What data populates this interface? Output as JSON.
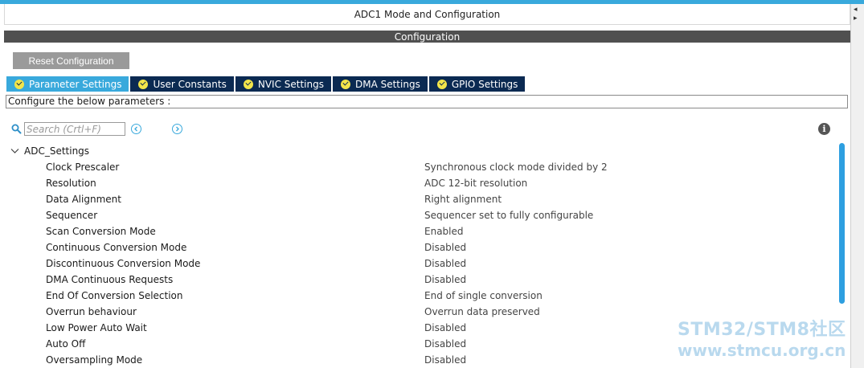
{
  "window": {
    "title": "ADC1 Mode and Configuration"
  },
  "config": {
    "header": "Configuration",
    "reset_label": "Reset Configuration"
  },
  "tabs": [
    {
      "label": "Parameter Settings",
      "active": true
    },
    {
      "label": "User Constants",
      "active": false
    },
    {
      "label": "NVIC Settings",
      "active": false
    },
    {
      "label": "DMA Settings",
      "active": false
    },
    {
      "label": "GPIO Settings",
      "active": false
    }
  ],
  "description": "Configure the below parameters :",
  "search": {
    "placeholder": "Search (Crtl+F)"
  },
  "group": {
    "label": "ADC_Settings",
    "expanded": true
  },
  "params": [
    {
      "name": "Clock Prescaler",
      "value": "Synchronous clock mode divided by 2"
    },
    {
      "name": "Resolution",
      "value": "ADC 12-bit resolution"
    },
    {
      "name": "Data Alignment",
      "value": "Right alignment"
    },
    {
      "name": "Sequencer",
      "value": "Sequencer set to fully configurable"
    },
    {
      "name": "Scan Conversion Mode",
      "value": "Enabled"
    },
    {
      "name": "Continuous Conversion Mode",
      "value": "Disabled"
    },
    {
      "name": "Discontinuous Conversion Mode",
      "value": "Disabled"
    },
    {
      "name": "DMA Continuous Requests",
      "value": "Disabled"
    },
    {
      "name": "End Of Conversion Selection",
      "value": "End of single conversion"
    },
    {
      "name": "Overrun behaviour",
      "value": "Overrun data preserved"
    },
    {
      "name": "Low Power Auto Wait",
      "value": "Disabled"
    },
    {
      "name": "Auto Off",
      "value": "Disabled"
    },
    {
      "name": "Oversampling Mode",
      "value": "Disabled"
    }
  ],
  "watermark": {
    "line1": "STM32/STM8社区",
    "line2": "www.stmcu.org.cn"
  },
  "colors": {
    "accent": "#39a9dc",
    "tab_bg": "#0b2a52",
    "check": "#f2e54a",
    "header_bg": "#505050",
    "reset_bg": "#9a9a9a",
    "scroll_thumb": "#2d9fe0"
  },
  "icons": {
    "search": "search-icon",
    "prev": "chevron-left-circle-icon",
    "next": "chevron-right-circle-icon",
    "info": "info-icon",
    "expand": "chevron-down-icon",
    "tab_status": "check-circle-icon"
  }
}
